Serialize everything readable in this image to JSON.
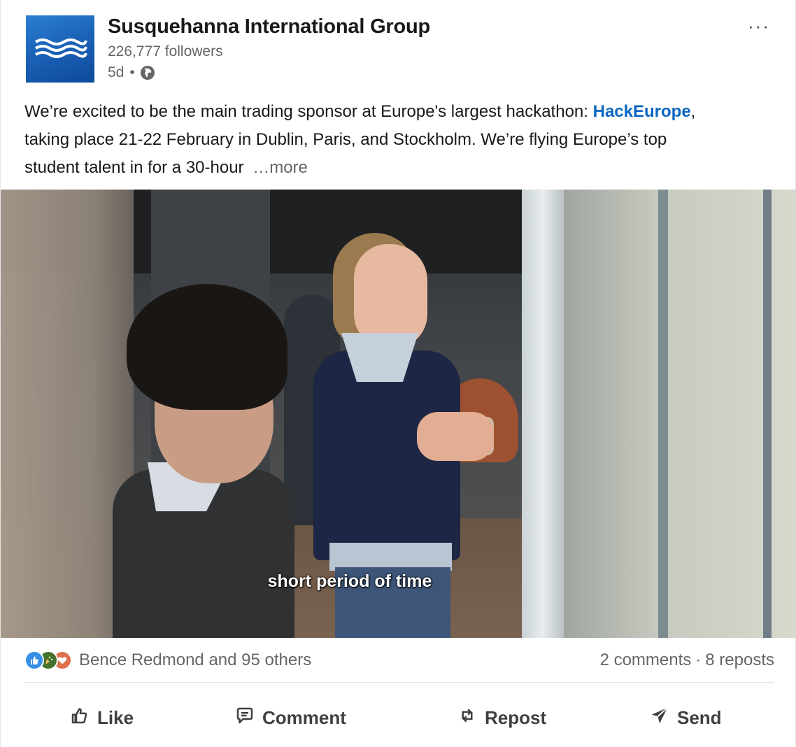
{
  "post": {
    "company_name": "Susquehanna International Group",
    "followers": "226,777 followers",
    "age": "5d",
    "dot": "•",
    "overflow_label": "···",
    "text_before": "We’re excited to be the main trading sponsor at Europe's largest hackathon: ",
    "hashtag": "HackEurope",
    "text_after": ", taking place 21-22 February in Dublin, Paris, and Stockholm. We’re flying Europe’s top student talent in for a 30-hour",
    "more_label": "…more"
  },
  "media": {
    "caption": "short period of time"
  },
  "social": {
    "reactions_names": "Bence Redmond and 95 others",
    "comments": "2 comments",
    "separator": "·",
    "reposts": "8 reposts",
    "reaction_icons": [
      "like-reaction-icon",
      "celebrate-reaction-icon",
      "love-reaction-icon"
    ]
  },
  "actions": {
    "like": "Like",
    "comment": "Comment",
    "repost": "Repost",
    "send": "Send"
  },
  "colors": {
    "link": "#0a66c2",
    "muted": "#666666",
    "like_blue": "#378fe9",
    "celebrate_green": "#44712e",
    "love_orange": "#df704d"
  }
}
